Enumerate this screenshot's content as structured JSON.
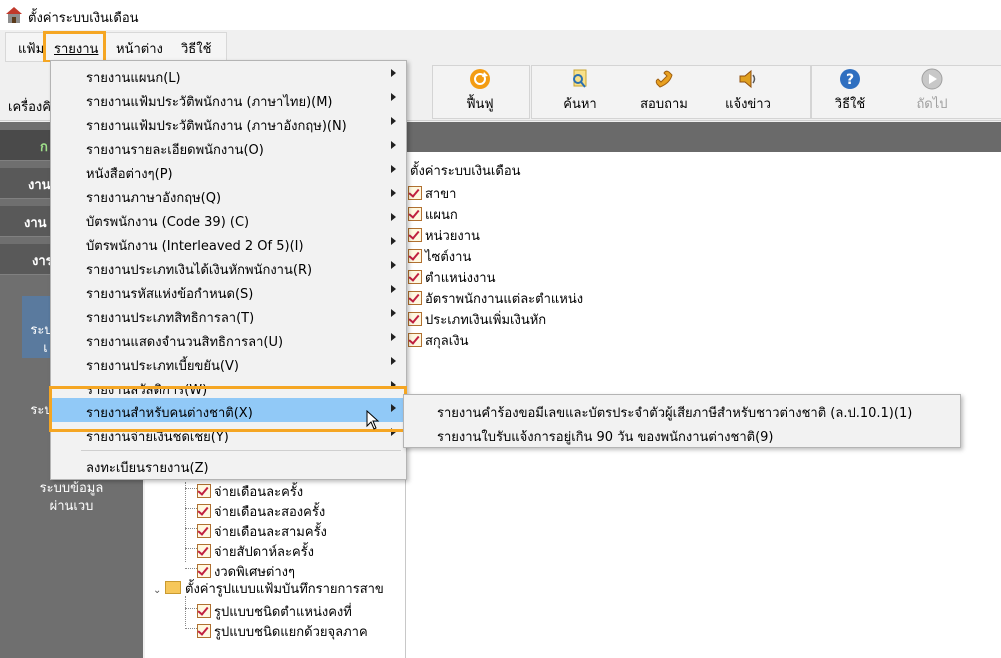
{
  "window": {
    "title": "ตั้งค่าระบบเงินเดือน"
  },
  "menubar": {
    "items": [
      {
        "label": "แฟ้ม"
      },
      {
        "label": "รายงาน"
      },
      {
        "label": "หน้าต่าง"
      },
      {
        "label": "วิธีใช้"
      }
    ]
  },
  "toolbar": {
    "left_label": "เครื่องคิ",
    "buttons": [
      {
        "label": "ฟื้นฟู",
        "icon": "refresh-icon"
      },
      {
        "label": "ค้นหา",
        "icon": "search-icon"
      },
      {
        "label": "สอบถาม",
        "icon": "phone-icon"
      },
      {
        "label": "แจ้งข่าว",
        "icon": "speaker-icon"
      },
      {
        "label": "วิธีใช้",
        "icon": "help-icon"
      },
      {
        "label": "ถัดไป",
        "icon": "next-icon",
        "disabled": true
      }
    ]
  },
  "left_panel": {
    "headers": [
      "ก",
      "งาน",
      "งาน",
      "งาร"
    ],
    "texts": [
      "ระบ",
      "เ",
      "ระบ",
      "ระบบข้อมูล",
      "ผ่านเวบ"
    ]
  },
  "report_menu": {
    "items": [
      {
        "label": "รายงานแผนก(L)",
        "submenu": true
      },
      {
        "label": "รายงานแฟ้มประวัติพนักงาน (ภาษาไทย)(M)",
        "submenu": true
      },
      {
        "label": "รายงานแฟ้มประวัติพนักงาน (ภาษาอังกฤษ)(N)",
        "submenu": true
      },
      {
        "label": "รายงานรายละเอียดพนักงาน(O)",
        "submenu": true
      },
      {
        "label": "หนังสือต่างๆ(P)",
        "submenu": true
      },
      {
        "label": "รายงานภาษาอังกฤษ(Q)",
        "submenu": true
      },
      {
        "label": "บัตรพนักงาน (Code 39) (C)",
        "submenu": true
      },
      {
        "label": "บัตรพนักงาน (Interleaved 2 Of 5)(I)",
        "submenu": true
      },
      {
        "label": "รายงานประเภทเงินได้เงินหักพนักงาน(R)",
        "submenu": true
      },
      {
        "label": "รายงานรหัสแห่งข้อกำหนด(S)",
        "submenu": true
      },
      {
        "label": "รายงานประเภทสิทธิการลา(T)",
        "submenu": true
      },
      {
        "label": "รายงานแสดงจำนวนสิทธิการลา(U)",
        "submenu": true
      },
      {
        "label": "รายงานประเภทเบี้ยขยัน(V)",
        "submenu": true
      },
      {
        "label": "รายงานสวัสดิการ(W)",
        "submenu": true
      },
      {
        "label": "รายงานสำหรับคนต่างชาติ(X)",
        "submenu": true,
        "active": true
      },
      {
        "label": "รายงานจ่ายเงินชดเชย(Y)",
        "submenu": true
      },
      {
        "label": "ลงทะเบียนรายงาน(Z)",
        "submenu": false
      }
    ]
  },
  "foreigner_submenu": {
    "items": [
      {
        "label": "รายงานคำร้องขอมีเลขและบัตรประจำตัวผู้เสียภาษีสำหรับชาวต่างชาติ (ล.ป.10.1)(1)"
      },
      {
        "label": "รายงานใบรับแจ้งการอยู่เกิน 90 วัน ของพนักงานต่างชาติ(9)"
      }
    ]
  },
  "tree": {
    "root": "ตั้งค่าระบบเงินเดือน",
    "items": [
      "สาขา",
      "แผนก",
      "หน่วยงาน",
      "ไซต์งาน",
      "ตำแหน่งงาน",
      "อัตราพนักงานแต่ละตำแหน่ง",
      "ประเภทเงินเพิ่มเงินหัก",
      "สกุลเงิน"
    ],
    "lower_items": [
      "จ่ายเดือนละครั้ง",
      "จ่ายเดือนละสองครั้ง",
      "จ่ายเดือนละสามครั้ง",
      "จ่ายสัปดาห์ละครั้ง",
      "งวดพิเศษต่างๆ"
    ],
    "folder_label": "ตั้งค่ารูปแบบแฟ้มบันทึกรายการสาข",
    "folder_children": [
      "รูปแบบชนิดตำแหน่งคงที่",
      "รูปแบบชนิดแยกด้วยจุลภาค"
    ]
  },
  "colors": {
    "highlight": "#f5a623",
    "menu_active": "#91c9f7"
  }
}
